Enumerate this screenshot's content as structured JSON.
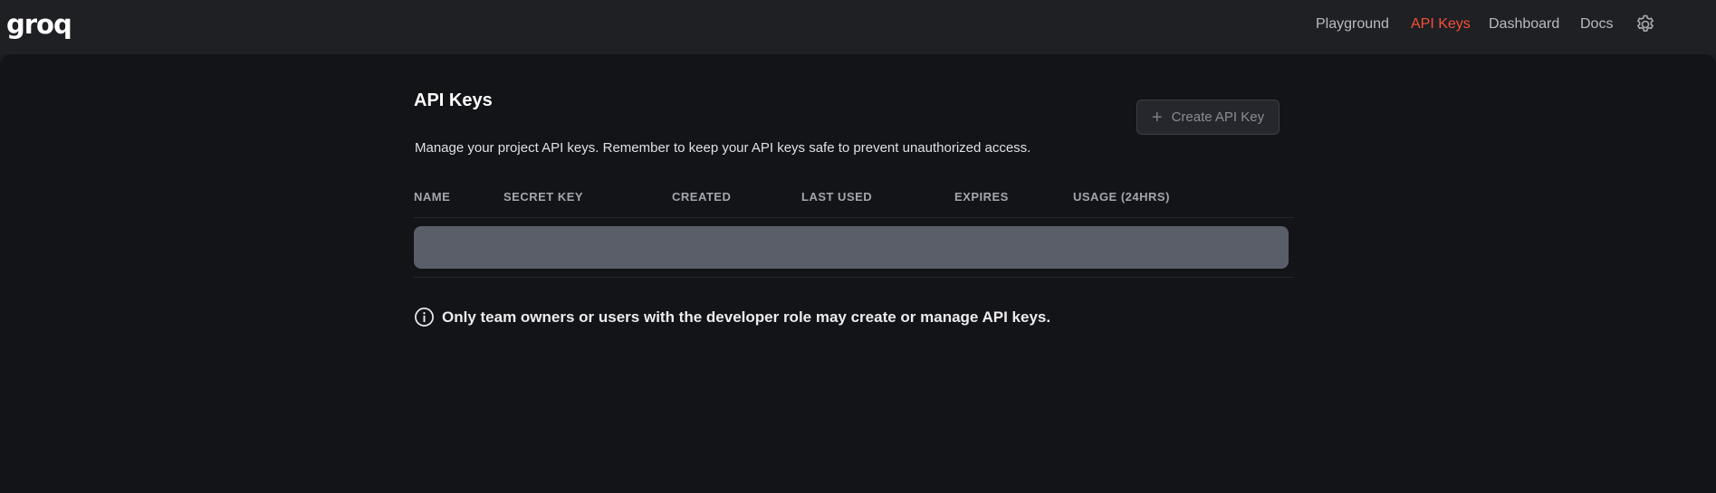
{
  "brand": {
    "logo_text": "groq"
  },
  "nav": {
    "items": [
      {
        "label": "Playground",
        "active": false
      },
      {
        "label": "API Keys",
        "active": true
      },
      {
        "label": "Dashboard",
        "active": false
      },
      {
        "label": "Docs",
        "active": false
      }
    ]
  },
  "page": {
    "title": "API Keys",
    "description": "Manage your project API keys. Remember to keep your API keys safe to prevent unauthorized access.",
    "create_button_label": "Create API Key",
    "create_button_icon": "plus-icon"
  },
  "table": {
    "columns": [
      "NAME",
      "SECRET KEY",
      "CREATED",
      "LAST USED",
      "EXPIRES",
      "USAGE (24HRS)"
    ]
  },
  "notice": {
    "icon": "info-icon",
    "text": "Only team owners or users with the developer role may create or manage API keys."
  },
  "colors": {
    "accent": "#f55036",
    "background": "#131418",
    "topbar": "#1f2024",
    "skeleton": "#5a5e69"
  }
}
